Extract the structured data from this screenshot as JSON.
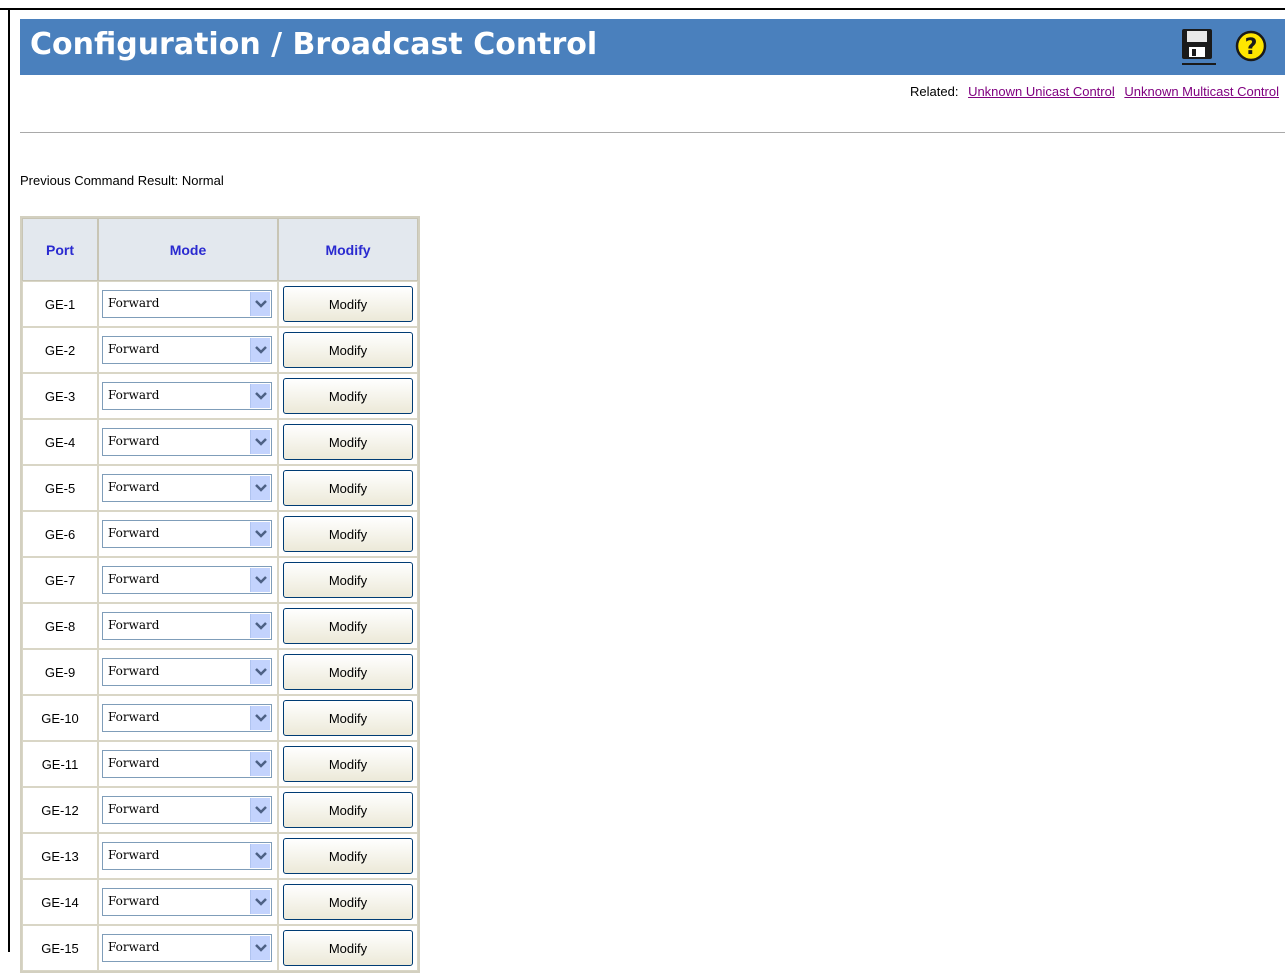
{
  "header": {
    "title": "Configuration / Broadcast Control",
    "save_icon": "floppy-disk-icon",
    "help_icon": "question-mark-icon",
    "brand_color": "#4a80bd"
  },
  "related": {
    "label": "Related:",
    "links": [
      "Unknown Unicast Control",
      "Unknown Multicast Control"
    ]
  },
  "status": {
    "previous_result": "Previous Command Result: Normal"
  },
  "table": {
    "columns": [
      "Port",
      "Mode",
      "Modify"
    ],
    "rows": [
      {
        "port": "GE-1",
        "mode": "Forward",
        "action": "Modify"
      },
      {
        "port": "GE-2",
        "mode": "Forward",
        "action": "Modify"
      },
      {
        "port": "GE-3",
        "mode": "Forward",
        "action": "Modify"
      },
      {
        "port": "GE-4",
        "mode": "Forward",
        "action": "Modify"
      },
      {
        "port": "GE-5",
        "mode": "Forward",
        "action": "Modify"
      },
      {
        "port": "GE-6",
        "mode": "Forward",
        "action": "Modify"
      },
      {
        "port": "GE-7",
        "mode": "Forward",
        "action": "Modify"
      },
      {
        "port": "GE-8",
        "mode": "Forward",
        "action": "Modify"
      },
      {
        "port": "GE-9",
        "mode": "Forward",
        "action": "Modify"
      },
      {
        "port": "GE-10",
        "mode": "Forward",
        "action": "Modify"
      },
      {
        "port": "GE-11",
        "mode": "Forward",
        "action": "Modify"
      },
      {
        "port": "GE-12",
        "mode": "Forward",
        "action": "Modify"
      },
      {
        "port": "GE-13",
        "mode": "Forward",
        "action": "Modify"
      },
      {
        "port": "GE-14",
        "mode": "Forward",
        "action": "Modify"
      },
      {
        "port": "GE-15",
        "mode": "Forward",
        "action": "Modify"
      }
    ]
  }
}
